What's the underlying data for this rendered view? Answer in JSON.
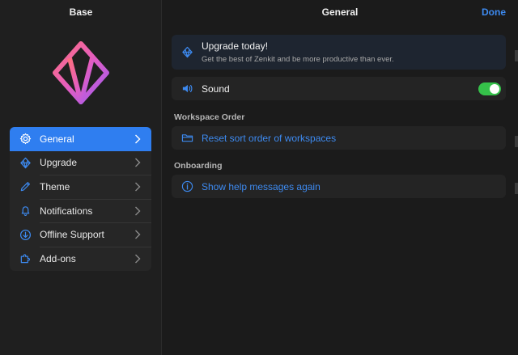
{
  "sidebar": {
    "title": "Base",
    "items": [
      {
        "label": "General",
        "icon": "gear-icon",
        "active": true
      },
      {
        "label": "Upgrade",
        "icon": "diamond-icon",
        "active": false
      },
      {
        "label": "Theme",
        "icon": "pencil-icon",
        "active": false
      },
      {
        "label": "Notifications",
        "icon": "bell-icon",
        "active": false
      },
      {
        "label": "Offline Support",
        "icon": "download-circle-icon",
        "active": false
      },
      {
        "label": "Add-ons",
        "icon": "puzzle-icon",
        "active": false
      }
    ]
  },
  "main": {
    "title": "General",
    "done_label": "Done",
    "upgrade": {
      "title": "Upgrade today!",
      "subtitle": "Get the best of Zenkit and be more productive than ever."
    },
    "sound": {
      "label": "Sound",
      "enabled": true
    },
    "workspace_order": {
      "header": "Workspace Order",
      "action_label": "Reset sort order of workspaces"
    },
    "onboarding": {
      "header": "Onboarding",
      "action_label": "Show help messages again"
    }
  },
  "colors": {
    "accent": "#2f7ef0",
    "link": "#3d8af0",
    "toggle_on": "#35c14a",
    "background": "#1b1b1b"
  }
}
